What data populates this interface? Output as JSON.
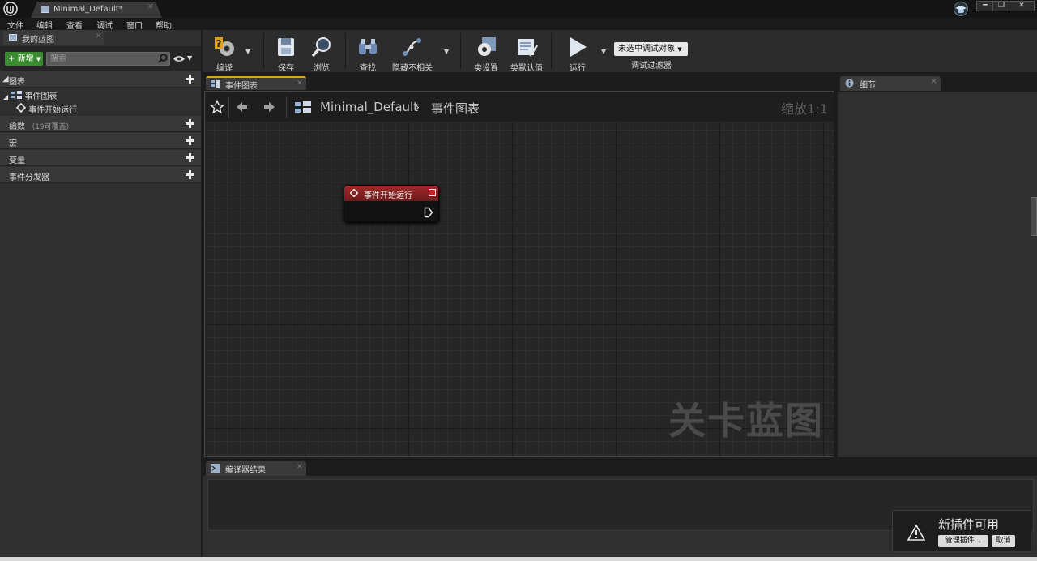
{
  "window": {
    "document_tab": "Minimal_Default*",
    "controls": [
      "━",
      "❐",
      "✕"
    ]
  },
  "menu": [
    "文件",
    "编辑",
    "查看",
    "调试",
    "窗口",
    "帮助"
  ],
  "left_panel": {
    "tab_label": "我的蓝图",
    "new_button": "新增",
    "search_placeholder": "搜索",
    "sections": {
      "graphs": "图表",
      "functions": "函数",
      "functions_hint": "（19可覆盖）",
      "macros": "宏",
      "variables": "变量",
      "dispatchers": "事件分发器"
    },
    "tree": {
      "event_graph": "事件图表",
      "begin_play": "事件开始运行"
    }
  },
  "toolbar": {
    "compile": "编译",
    "save": "保存",
    "browse": "浏览",
    "find": "查找",
    "hide_unrelated": "隐藏不相关",
    "class_settings": "类设置",
    "class_defaults": "类默认值",
    "play": "运行",
    "debug_object": "未选中调试对象",
    "debug_filter": "调试过滤器"
  },
  "graph": {
    "tab_label": "事件图表",
    "breadcrumb_root": "Minimal_Default",
    "breadcrumb_page": "事件图表",
    "zoom": "缩放1:1",
    "watermark": "关卡蓝图",
    "node_title": "事件开始运行"
  },
  "details": {
    "tab_label": "细节"
  },
  "compiler": {
    "tab_label": "编译器结果"
  },
  "notification": {
    "title": "新插件可用",
    "manage_button": "管理插件...",
    "cancel_button": "取消"
  },
  "colors": {
    "accent_tab": "#e3a21a",
    "new_button": "#3a8d2f",
    "event_node_header": "#9c2a2a",
    "background": "#1c1c1c"
  }
}
